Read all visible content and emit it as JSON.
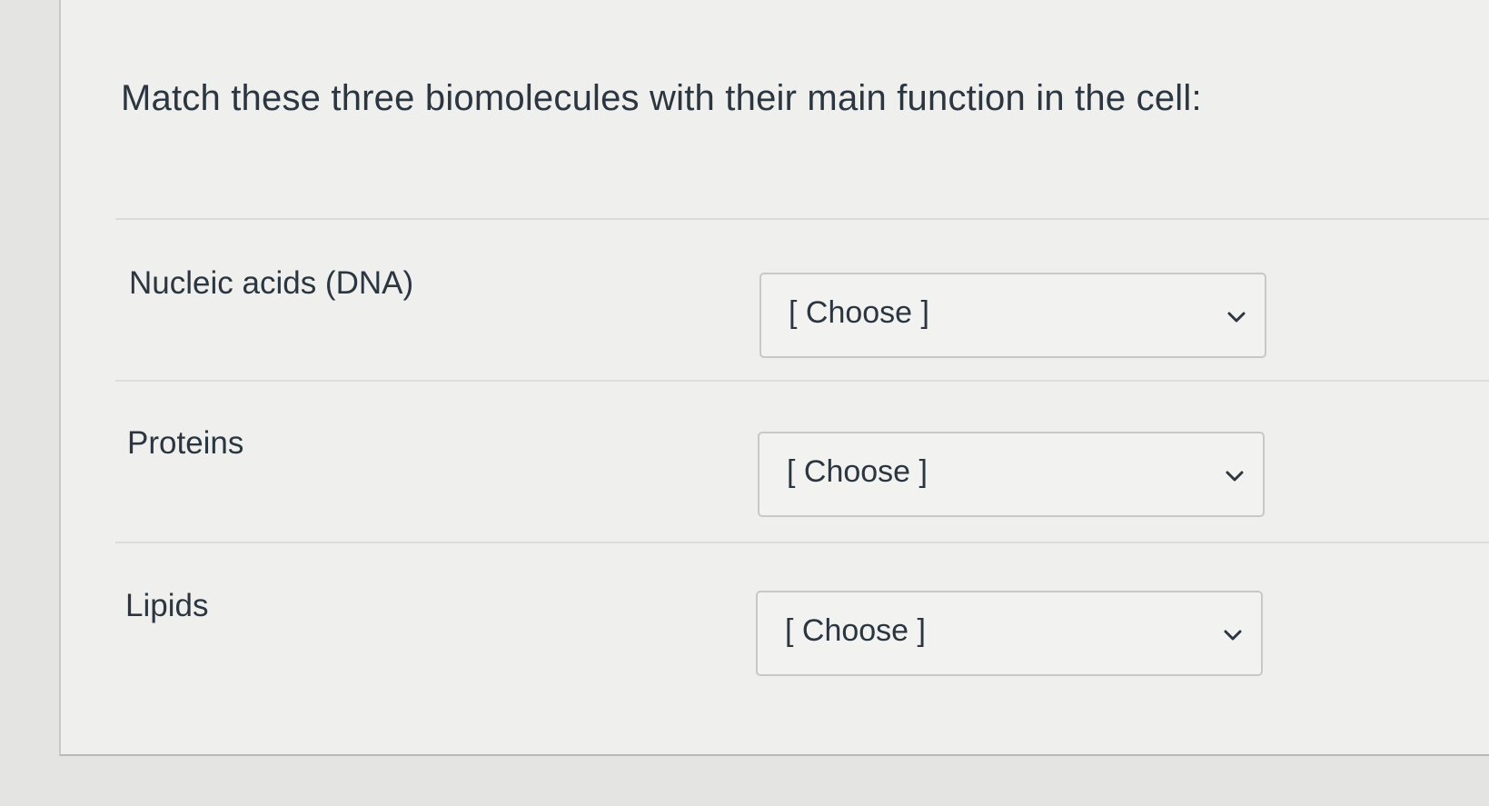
{
  "question": {
    "text": "Match these three biomolecules with their main function in the cell:"
  },
  "rows": [
    {
      "label": "Nucleic acids (DNA)",
      "select": {
        "value": "[ Choose ]",
        "icon": "chevron-down-icon"
      }
    },
    {
      "label": "Proteins",
      "select": {
        "value": "[ Choose ]",
        "icon": "chevron-down-icon"
      }
    },
    {
      "label": "Lipids",
      "select": {
        "value": "[ Choose ]",
        "icon": "chevron-down-icon"
      }
    }
  ]
}
